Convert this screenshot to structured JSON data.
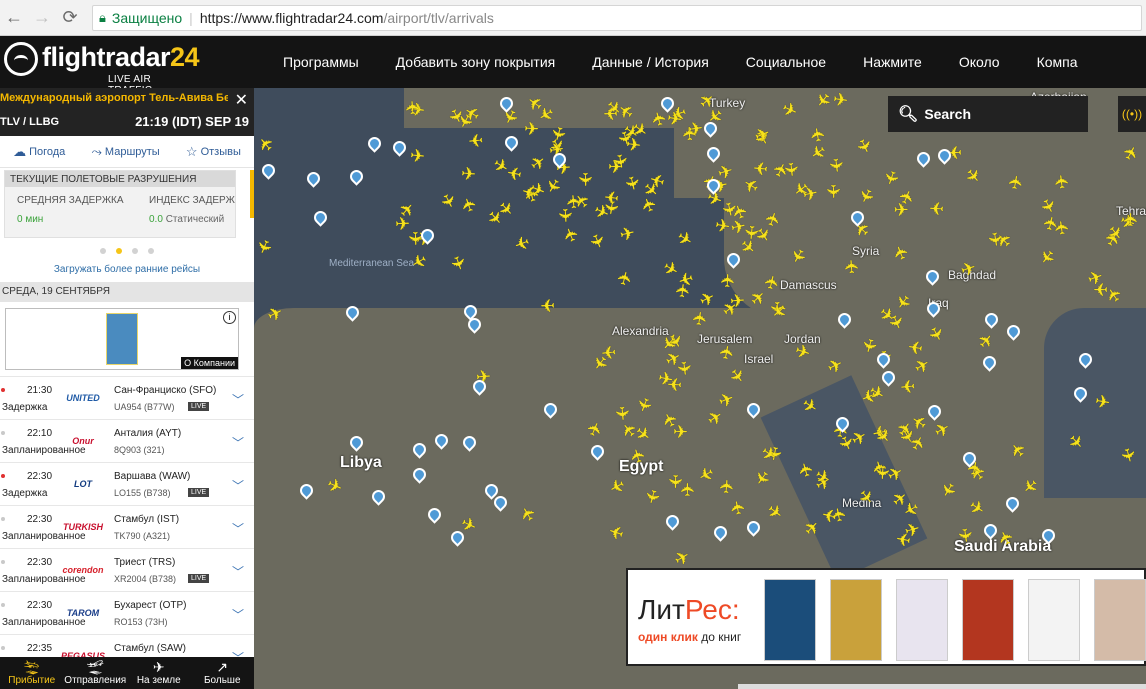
{
  "browser": {
    "secure_label": "Защищено",
    "url_host": "https://www.flightradar24.com",
    "url_path": "/airport/tlv/arrivals"
  },
  "header": {
    "logo_text": "flightradar",
    "logo_num": "24",
    "logo_sub": "LIVE AIR TRAFFIC",
    "menu": [
      "Программы",
      "Добавить зону покрытия",
      "Данные / История",
      "Социальное",
      "Нажмите",
      "Около",
      "Компа"
    ]
  },
  "sidebar": {
    "airport_name": "Международный аэропорт Тель-Авива Бен-Г",
    "codes": "TLV / LLBG",
    "local_time": "21:19 (IDT) SEP 19",
    "tabs": [
      {
        "label": "Погода",
        "icon": "weather-icon"
      },
      {
        "label": "Маршруты",
        "icon": "routes-icon"
      },
      {
        "label": "Отзывы",
        "icon": "star-icon"
      }
    ],
    "delays": {
      "title": "ТЕКУЩИЕ ПОЛЕТОВЫЕ РАЗРУШЕНИЯ",
      "avg_label": "СРЕДНЯЯ ЗАДЕРЖКА",
      "avg_value": "0 мин",
      "index_label": "ИНДЕКС ЗАДЕРЖ",
      "index_value": "0.0",
      "index_status": "Статический"
    },
    "load_earlier": "Загружать более ранние рейсы",
    "date_header": "СРЕДА, 19 СЕНТЯБРЯ",
    "ad_label": "О Компании",
    "flights": [
      {
        "time": "21:30",
        "status": "Задержка",
        "delayed": true,
        "airline": "UNITED",
        "airline_color": "#1f5aa6",
        "dest": "Сан-Франциско  (SFO)",
        "fno": "UA954 (B77W)",
        "live": "LIVE"
      },
      {
        "time": "22:10",
        "status": "Запланированное",
        "delayed": false,
        "airline": "Onur",
        "airline_color": "#c8102e",
        "dest": "Анталия  (AYT)",
        "fno": "8Q903 (321)",
        "live": ""
      },
      {
        "time": "22:30",
        "status": "Задержка",
        "delayed": true,
        "airline": "LOT",
        "airline_color": "#123b80",
        "dest": "Варшава  (WAW)",
        "fno": "LO155 (B738)",
        "live": "LIVE"
      },
      {
        "time": "22:30",
        "status": "Запланированное",
        "delayed": false,
        "airline": "TURKISH",
        "airline_color": "#c8102e",
        "dest": "Стамбул  (IST)",
        "fno": "TK790 (A321)",
        "live": ""
      },
      {
        "time": "22:30",
        "status": "Запланированное",
        "delayed": false,
        "airline": "corendon",
        "airline_color": "#d61f2a",
        "dest": "Триест  (TRS)",
        "fno": "XR2004 (B738)",
        "live": "LIVE"
      },
      {
        "time": "22:30",
        "status": "Запланированное",
        "delayed": false,
        "airline": "TAROM",
        "airline_color": "#1c3f8a",
        "dest": "Бухарест  (OTP)",
        "fno": "RO153 (73H)",
        "live": ""
      },
      {
        "time": "22:35",
        "status": "Запланированное",
        "delayed": false,
        "airline": "PEGASUS",
        "airline_color": "#c8102e",
        "dest": "Стамбул  (SAW)",
        "fno": "",
        "live": ""
      }
    ],
    "bottom_tabs": [
      {
        "label": "Прибытие",
        "icon": "arrival-icon",
        "active": true
      },
      {
        "label": "Отправления",
        "icon": "departure-icon",
        "active": false
      },
      {
        "label": "На земле",
        "icon": "ground-icon",
        "active": false
      },
      {
        "label": "Больше",
        "icon": "external-icon",
        "active": false
      }
    ]
  },
  "map": {
    "search_placeholder": "Search",
    "labels": [
      {
        "text": "Mediterranean Sea",
        "kind": "sea"
      },
      {
        "text": "Libya",
        "kind": "big"
      },
      {
        "text": "Egypt",
        "kind": "big"
      },
      {
        "text": "Syria",
        "kind": "normal"
      },
      {
        "text": "Iraq",
        "kind": "normal"
      },
      {
        "text": "Jordan",
        "kind": "normal"
      },
      {
        "text": "Jerusalem",
        "kind": "normal"
      },
      {
        "text": "Damascus",
        "kind": "normal"
      },
      {
        "text": "Alexandria",
        "kind": "normal"
      },
      {
        "text": "Israel",
        "kind": "normal"
      },
      {
        "text": "Azerbaijan",
        "kind": "normal"
      },
      {
        "text": "Turkey",
        "kind": "normal"
      },
      {
        "text": "Medina",
        "kind": "normal"
      },
      {
        "text": "Saudi Arabia",
        "kind": "big"
      },
      {
        "text": "Baghdad",
        "kind": "normal"
      },
      {
        "text": "Tehran",
        "kind": "normal"
      }
    ]
  },
  "ad": {
    "brand_a": "Лит",
    "brand_b": "Рес:",
    "slogan_a": "один клик",
    "slogan_b": " до книг",
    "colors": [
      "#1b4d7a",
      "#c9a13b",
      "#e8e4ef",
      "#b3361f",
      "#f3f3f3",
      "#d4bba8"
    ]
  }
}
